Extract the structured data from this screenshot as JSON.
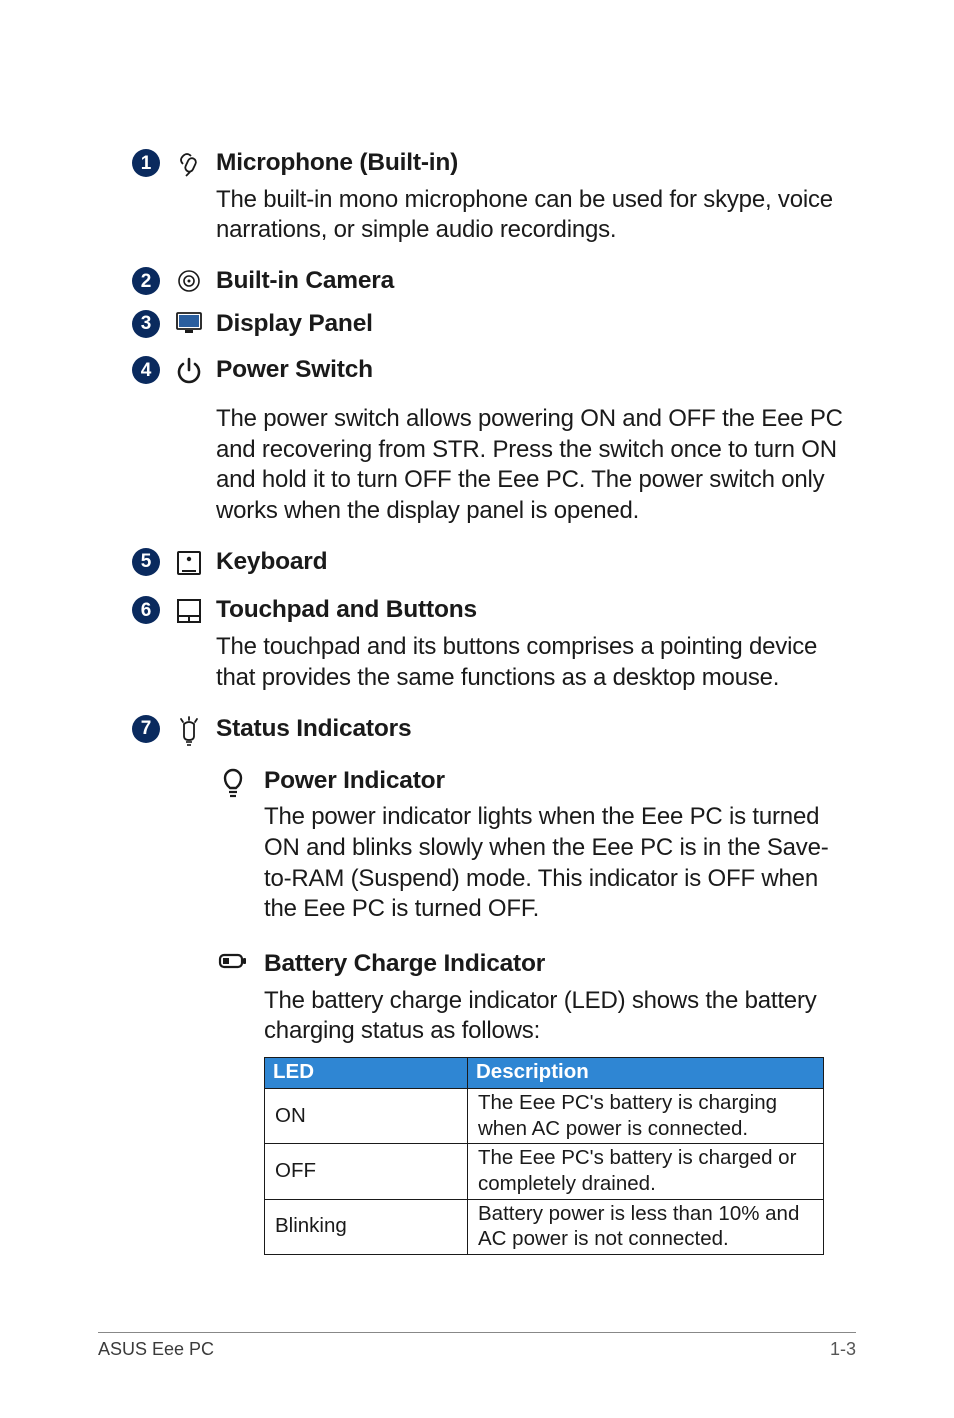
{
  "items": [
    {
      "num": "1",
      "icon": "microphone-icon",
      "title": "Microphone (Built-in)",
      "body": "The built-in mono microphone can be used for skype, voice narrations, or simple audio recordings."
    },
    {
      "num": "2",
      "icon": "camera-icon",
      "title": "Built-in Camera"
    },
    {
      "num": "3",
      "icon": "display-icon",
      "title": "Display Panel"
    },
    {
      "num": "4",
      "icon": "power-icon",
      "title": "Power Switch",
      "body": "The power switch allows powering ON and OFF the Eee PC and recovering from STR. Press the switch once to turn ON and hold it to turn OFF the Eee PC. The power switch only works when the display panel is opened."
    },
    {
      "num": "5",
      "icon": "keyboard-icon",
      "title": "Keyboard"
    },
    {
      "num": "6",
      "icon": "touchpad-icon",
      "title": "Touchpad and Buttons",
      "body": "The touchpad and its buttons comprises a pointing device that provides the same functions as a desktop mouse."
    },
    {
      "num": "7",
      "icon": "status-icon",
      "title": "Status Indicators"
    }
  ],
  "sub": {
    "power": {
      "title": "Power Indicator",
      "body": "The power indicator lights when the Eee PC is turned ON and blinks slowly when the Eee PC is in the Save-to-RAM (Suspend) mode. This indicator is OFF when the Eee PC is turned OFF."
    },
    "battery": {
      "title": "Battery Charge Indicator",
      "body": "The battery charge indicator (LED) shows the battery charging status as follows:"
    }
  },
  "table": {
    "headers": [
      "LED",
      "Description"
    ],
    "rows": [
      {
        "led": "ON",
        "desc": "The Eee PC's battery is charging when AC power is connected."
      },
      {
        "led": "OFF",
        "desc": "The Eee PC's battery is charged or completely drained."
      },
      {
        "led": "Blinking",
        "desc": "Battery power is less than 10% and AC power is not connected."
      }
    ]
  },
  "footer": {
    "left": "ASUS Eee PC",
    "right": "1-3"
  }
}
